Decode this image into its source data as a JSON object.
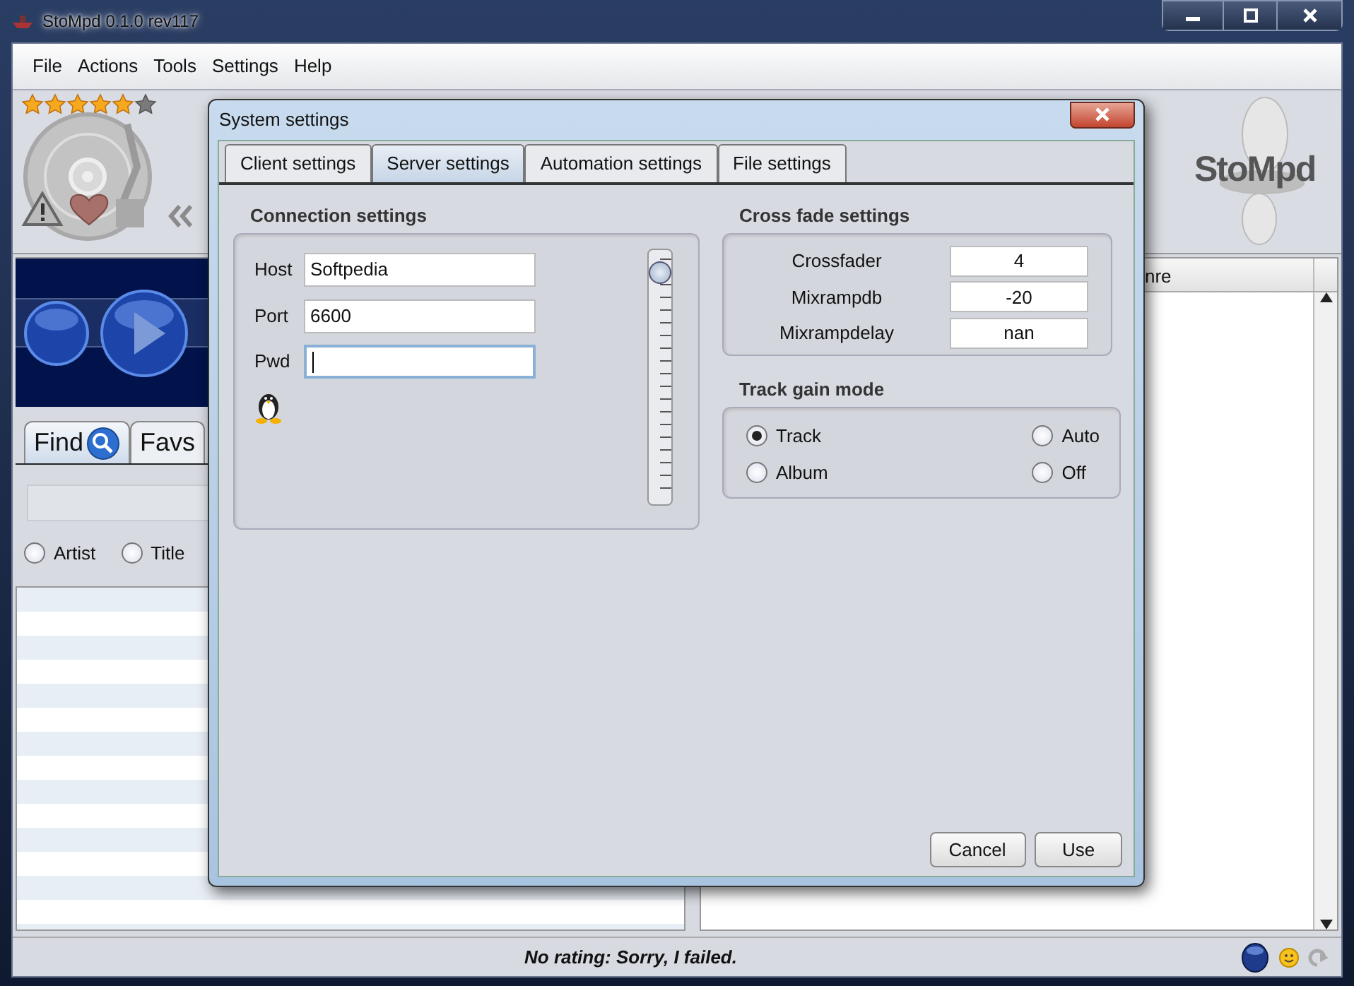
{
  "window": {
    "title": "StoMpd 0.1.0 rev117"
  },
  "menu": [
    "File",
    "Actions",
    "Tools",
    "Settings",
    "Help"
  ],
  "rating": {
    "stars": 5
  },
  "logo": "StoMpd",
  "left_panel": {
    "tabs": [
      {
        "label": "Find",
        "selected": true
      },
      {
        "label": "Favs",
        "selected": false
      }
    ],
    "search_options": [
      {
        "label": "Artist",
        "selected": false
      },
      {
        "label": "Title",
        "selected": false
      }
    ]
  },
  "playlist": {
    "columns": [
      "nre"
    ]
  },
  "status_bar": {
    "message": "No rating: Sorry, I failed."
  },
  "dialog": {
    "title": "System settings",
    "tabs": [
      {
        "label": "Client settings",
        "selected": false
      },
      {
        "label": "Server settings",
        "selected": true
      },
      {
        "label": "Automation settings",
        "selected": false
      },
      {
        "label": "File settings",
        "selected": false
      }
    ],
    "connection": {
      "title": "Connection settings",
      "fields": [
        {
          "label": "Host",
          "value": "Softpedia",
          "focused": false
        },
        {
          "label": "Port",
          "value": "6600",
          "focused": false
        },
        {
          "label": "Pwd",
          "focused": true
        }
      ],
      "slider": {
        "level": 0.95
      }
    },
    "crossfade": {
      "title": "Cross fade settings",
      "fields": [
        {
          "label": "Crossfader",
          "value": "4"
        },
        {
          "label": "Mixrampdb",
          "value": "-20"
        },
        {
          "label": "Mixrampdelay",
          "value": "nan"
        }
      ]
    },
    "track_gain": {
      "title": "Track gain mode",
      "options": [
        {
          "label": "Track",
          "selected": true
        },
        {
          "label": "Auto",
          "selected": false
        },
        {
          "label": "Album",
          "selected": false
        },
        {
          "label": "Off",
          "selected": false
        }
      ]
    },
    "buttons": [
      "Cancel",
      "Use"
    ]
  }
}
